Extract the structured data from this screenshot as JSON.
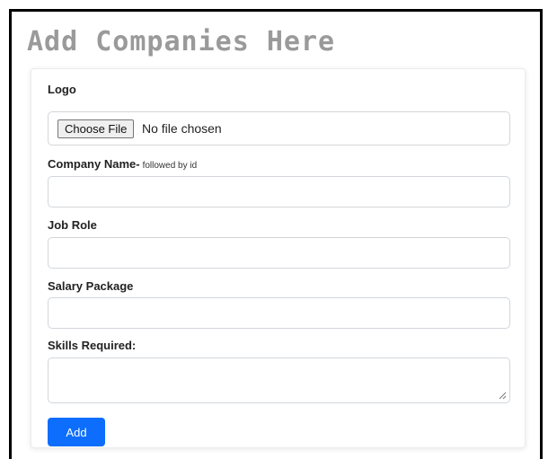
{
  "page": {
    "title": "Add Companies Here"
  },
  "form": {
    "logo": {
      "label": "Logo",
      "button_label": "Choose File",
      "status": "No file chosen"
    },
    "company_name": {
      "label": "Company Name-",
      "hint": "followed by id",
      "value": ""
    },
    "job_role": {
      "label": "Job Role",
      "value": ""
    },
    "salary_package": {
      "label": "Salary Package",
      "value": ""
    },
    "skills_required": {
      "label": "Skills Required:",
      "value": ""
    },
    "submit_label": "Add"
  },
  "colors": {
    "title": "#9a9a9a",
    "primary_button": "#0d6efd",
    "input_border": "#d2d6da"
  }
}
